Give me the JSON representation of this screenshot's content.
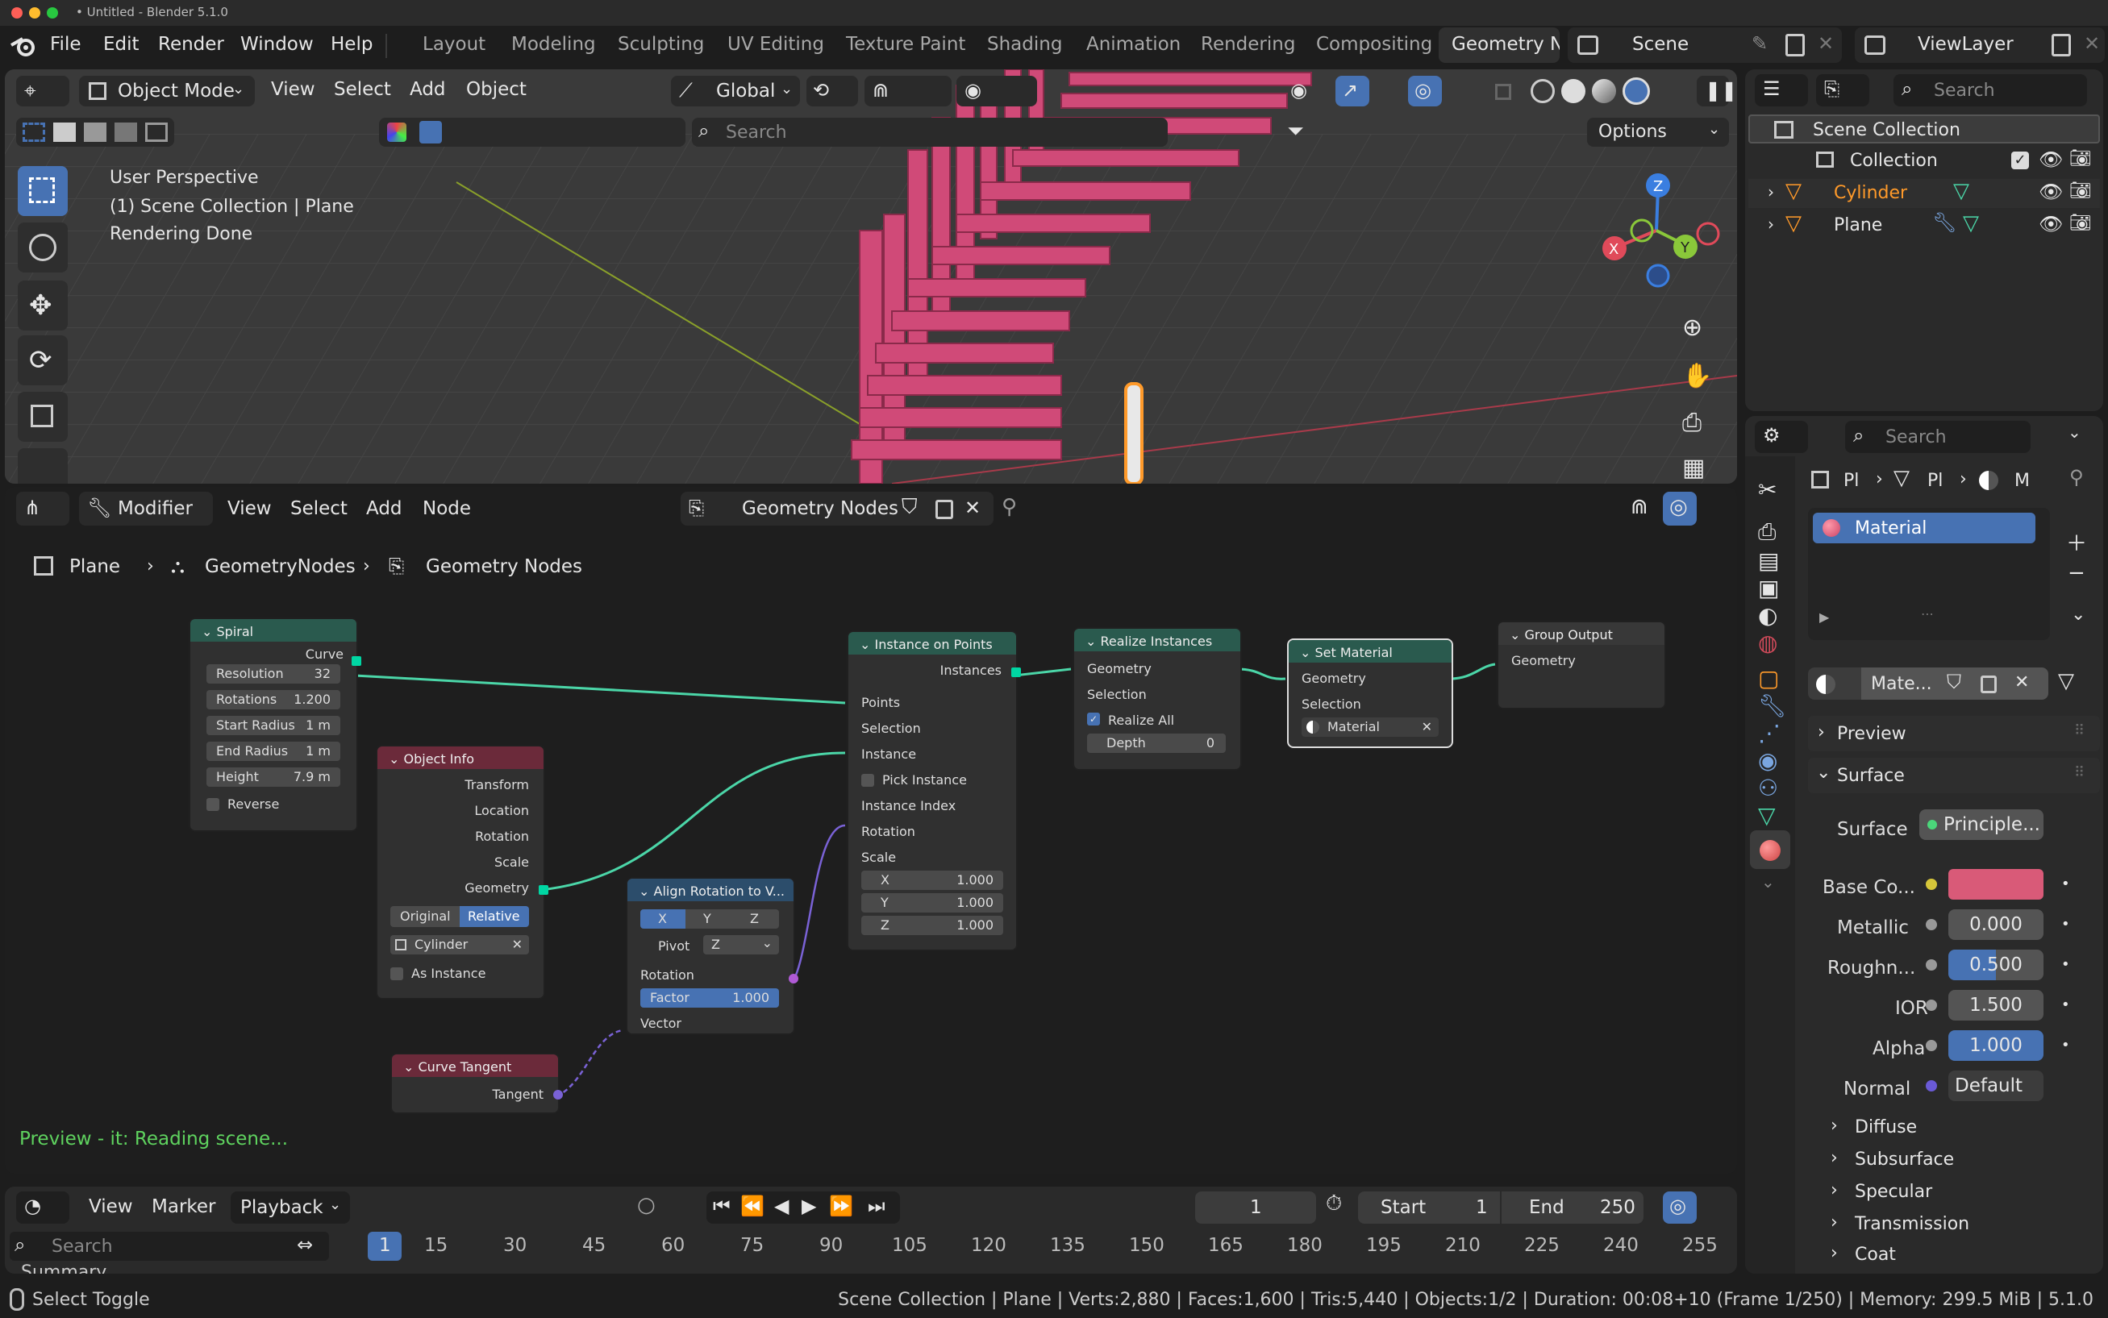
{
  "window": {
    "title": "• Untitled - Blender 5.1.0"
  },
  "menu": {
    "file": "File",
    "edit": "Edit",
    "render": "Render",
    "window": "Window",
    "help": "Help"
  },
  "workspaces": [
    "Layout",
    "Modeling",
    "Sculpting",
    "UV Editing",
    "Texture Paint",
    "Shading",
    "Animation",
    "Rendering",
    "Compositing",
    "Geometry No"
  ],
  "scene": {
    "name": "Scene",
    "view_layer": "ViewLayer"
  },
  "viewport": {
    "mode": "Object Mode",
    "view": "View",
    "select": "Select",
    "add": "Add",
    "object": "Object",
    "orientation": "Global",
    "search_placeholder": "Search",
    "options": "Options",
    "overlay_line1": "User Perspective",
    "overlay_line2": "(1) Scene Collection | Plane",
    "overlay_line3": "Rendering Done",
    "gizmo": {
      "x": "X",
      "y": "Y",
      "z": "Z"
    }
  },
  "node_editor": {
    "type": "Modifier",
    "view": "View",
    "select": "Select",
    "add": "Add",
    "node": "Node",
    "tree_name": "Geometry Nodes",
    "breadcrumb": [
      "Plane",
      "GeometryNodes",
      "Geometry Nodes"
    ],
    "status": "Preview - it: Reading scene...",
    "nodes": {
      "spiral": {
        "title": "Spiral",
        "out": "Curve",
        "resolution_label": "Resolution",
        "resolution": "32",
        "rotations_label": "Rotations",
        "rotations": "1.200",
        "start_radius_label": "Start Radius",
        "start_radius": "1 m",
        "end_radius_label": "End Radius",
        "end_radius": "1 m",
        "height_label": "Height",
        "height": "7.9 m",
        "reverse": "Reverse"
      },
      "object_info": {
        "title": "Object Info",
        "transform": "Transform",
        "location": "Location",
        "rotation": "Rotation",
        "scale": "Scale",
        "geometry": "Geometry",
        "original": "Original",
        "relative": "Relative",
        "object": "Cylinder",
        "as_instance": "As Instance"
      },
      "curve_tangent": {
        "title": "Curve Tangent",
        "tangent": "Tangent"
      },
      "align": {
        "title": "Align Rotation to V...",
        "x": "X",
        "y": "Y",
        "z": "Z",
        "pivot_label": "Pivot",
        "pivot": "Z",
        "rotation": "Rotation",
        "factor_label": "Factor",
        "factor": "1.000",
        "vector": "Vector"
      },
      "iop": {
        "title": "Instance on Points",
        "instances": "Instances",
        "points": "Points",
        "selection": "Selection",
        "instance": "Instance",
        "pick_instance": "Pick Instance",
        "instance_index": "Instance Index",
        "rotation": "Rotation",
        "scale": "Scale",
        "sx_label": "X",
        "sx": "1.000",
        "sy_label": "Y",
        "sy": "1.000",
        "sz_label": "Z",
        "sz": "1.000"
      },
      "realize": {
        "title": "Realize Instances",
        "geometry": "Geometry",
        "selection": "Selection",
        "realize_all": "Realize All",
        "depth_label": "Depth",
        "depth": "0"
      },
      "set_material": {
        "title": "Set Material",
        "geometry": "Geometry",
        "selection": "Selection",
        "material": "Material"
      },
      "group_output": {
        "title": "Group Output",
        "geometry": "Geometry"
      }
    }
  },
  "timeline": {
    "view": "View",
    "marker": "Marker",
    "playback": "Playback",
    "current_frame": "1",
    "start_label": "Start",
    "start": "1",
    "end_label": "End",
    "end": "250",
    "search_placeholder": "Search",
    "summary": "Summary",
    "ticks": [
      "1",
      "15",
      "30",
      "45",
      "60",
      "75",
      "90",
      "105",
      "120",
      "135",
      "150",
      "165",
      "180",
      "195",
      "210",
      "225",
      "240",
      "255"
    ]
  },
  "status_bar": {
    "left": "Select Toggle",
    "right": "Scene Collection | Plane | Verts:2,880 | Faces:1,600 | Tris:5,440 | Objects:1/2 | Duration: 00:08+10 (Frame 1/250) | Memory: 299.5 MiB | 5.1.0"
  },
  "outliner": {
    "search_placeholder": "Search",
    "scene_collection": "Scene Collection",
    "collection": "Collection",
    "items": [
      {
        "name": "Cylinder"
      },
      {
        "name": "Plane"
      }
    ]
  },
  "properties": {
    "search_placeholder": "Search",
    "breadcrumb": [
      "Pl",
      "Pl",
      "M"
    ],
    "material_slot": "Material",
    "material_name": "Mate...",
    "preview": "Preview",
    "surface_panel": "Surface",
    "surface_label": "Surface",
    "surface_value": "Principle...",
    "base_color_label": "Base Co...",
    "base_color": "#d95a78",
    "metallic_label": "Metallic",
    "metallic": "0.000",
    "roughness_label": "Roughn...",
    "roughness": "0.500",
    "ior_label": "IOR",
    "ior": "1.500",
    "alpha_label": "Alpha",
    "alpha": "1.000",
    "normal_label": "Normal",
    "normal": "Default",
    "subpanels": [
      "Diffuse",
      "Subsurface",
      "Specular",
      "Transmission",
      "Coat"
    ]
  },
  "colors": {
    "accent": "#4772b3",
    "geometry_socket": "#00d6a3",
    "node_green": "#2a5a4e",
    "node_red": "#6b2a3a",
    "node_blue": "#2c4d6b",
    "mesh": "#d04a78"
  }
}
